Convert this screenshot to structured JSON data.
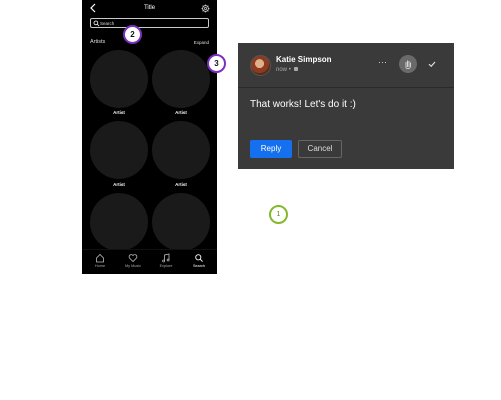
{
  "phone": {
    "title": "Title",
    "search": {
      "placeholder": "Search",
      "value": ""
    },
    "section": {
      "label": "Artists",
      "expand_label": "Expand"
    },
    "artists": [
      {
        "label": "Artist"
      },
      {
        "label": "Artist"
      },
      {
        "label": "Artist"
      },
      {
        "label": "Artist"
      },
      {
        "label": "",
        "partial": true
      },
      {
        "label": "",
        "partial": true
      }
    ],
    "tabs": [
      {
        "label": "Home",
        "icon": "home-icon"
      },
      {
        "label": "My Music",
        "icon": "heart-icon"
      },
      {
        "label": "Explore",
        "icon": "music-note-icon"
      },
      {
        "label": "Search",
        "icon": "search-icon",
        "active": true
      }
    ]
  },
  "badges": {
    "one": "1",
    "two": "2",
    "three": "3"
  },
  "comment": {
    "author": "Katie Simpson",
    "time": "now",
    "separator": "•",
    "more_label": "···",
    "body": "That works! Let's do it :)",
    "reply_label": "Reply",
    "cancel_label": "Cancel"
  },
  "colors": {
    "badge_purple": "#7b2fbf",
    "badge_green": "#86b82c",
    "reply_blue": "#1570ef",
    "card_bg": "#3a3a3a"
  }
}
